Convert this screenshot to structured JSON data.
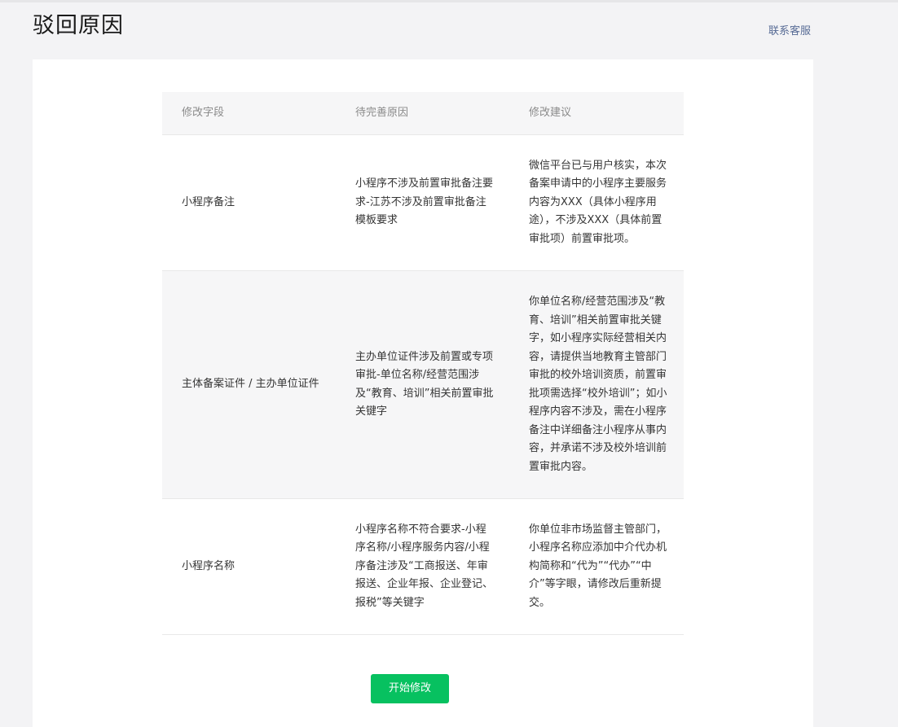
{
  "header": {
    "title": "驳回原因",
    "contact_link": "联系客服"
  },
  "table": {
    "columns": [
      "修改字段",
      "待完善原因",
      "修改建议"
    ],
    "rows": [
      {
        "field": "小程序备注",
        "reason": "小程序不涉及前置审批备注要求-江苏不涉及前置审批备注模板要求",
        "suggestion": "微信平台已与用户核实，本次备案申请中的小程序主要服务内容为XXX（具体小程序用途），不涉及XXX（具体前置审批项）前置审批项。"
      },
      {
        "field": "主体备案证件 / 主办单位证件",
        "reason": "主办单位证件涉及前置或专项审批-单位名称/经营范围涉及“教育、培训”相关前置审批关键字",
        "suggestion": "你单位名称/经营范围涉及“教育、培训”相关前置审批关键字，如小程序实际经营相关内容，请提供当地教育主管部门审批的校外培训资质，前置审批项需选择“校外培训”；如小程序内容不涉及，需在小程序备注中详细备注小程序从事内容，并承诺不涉及校外培训前置审批内容。"
      },
      {
        "field": "小程序名称",
        "reason": "小程序名称不符合要求-小程序名称/小程序服务内容/小程序备注涉及“工商报送、年审报送、企业年报、企业登记、报税”等关键字",
        "suggestion": "你单位非市场监督主管部门，小程序名称应添加中介代办机构简称和“代为”“代办”“中介”等字眼，请修改后重新提交。"
      }
    ]
  },
  "actions": {
    "start_edit": "开始修改"
  },
  "colors": {
    "primary_button": "#07c160",
    "link": "#576b95"
  }
}
